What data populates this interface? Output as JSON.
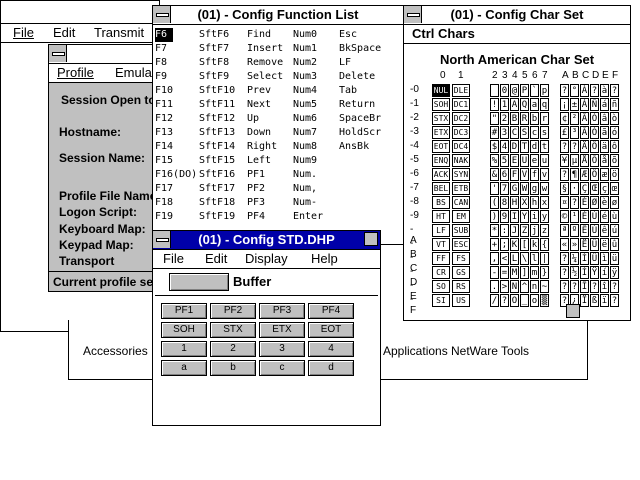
{
  "back_window": {
    "menu": [
      "File",
      "Edit",
      "Transmit"
    ]
  },
  "session_window": {
    "menu": [
      "Profile",
      "Emula"
    ],
    "session_open": "Session Open to",
    "hostname_label": "Hostname:",
    "session_name_label": "Session Name:",
    "profile_file_label": "Profile File Name",
    "logon_script_label": "Logon Script:",
    "keyboard_map_label": "Keyboard Map:",
    "keypad_map_label": "Keypad Map:",
    "transport_label": "Transport",
    "status": "Current profile se"
  },
  "program_manager": {
    "groups": [
      "Accessories",
      "Applications",
      "NetWare Tools"
    ]
  },
  "func_list": {
    "title": "(01) - Config Function List",
    "rows": [
      [
        "F6",
        "SftF6",
        "Find",
        "Num0",
        "Esc"
      ],
      [
        "F7",
        "SftF7",
        "Insert",
        "Num1",
        "BkSpace"
      ],
      [
        "F8",
        "SftF8",
        "Remove",
        "Num2",
        "LF"
      ],
      [
        "F9",
        "SftF9",
        "Select",
        "Num3",
        "Delete"
      ],
      [
        "F10",
        "SftF10",
        "Prev",
        "Num4",
        "Tab"
      ],
      [
        "F11",
        "SftF11",
        "Next",
        "Num5",
        "Return"
      ],
      [
        "F12",
        "SftF12",
        "Up",
        "Num6",
        "SpaceBr"
      ],
      [
        "F13",
        "SftF13",
        "Down",
        "Num7",
        "HoldScr"
      ],
      [
        "F14",
        "SftF14",
        "Right",
        "Num8",
        "AnsBk"
      ],
      [
        "F15",
        "SftF15",
        "Left",
        "Num9",
        ""
      ],
      [
        "F16(DO)",
        "SftF16",
        "PF1",
        "Num.",
        ""
      ],
      [
        "F17",
        "SftF17",
        "PF2",
        "Num,",
        ""
      ],
      [
        "F18",
        "SftF18",
        "PF3",
        "Num-",
        ""
      ],
      [
        "F19",
        "SftF19",
        "PF4",
        "Enter",
        ""
      ]
    ]
  },
  "char_set": {
    "title": "(01) - Config Char Set",
    "menu": "Ctrl Chars",
    "heading": "North American Char Set",
    "col_labels": [
      "0",
      "1",
      "2",
      "3",
      "4",
      "5",
      "6",
      "7",
      "A",
      "B",
      "C",
      "D",
      "E",
      "F"
    ],
    "row_labels": [
      "-0",
      "-1",
      "-2",
      "-3",
      "-4",
      "-5",
      "-6",
      "-7",
      "-8",
      "-9",
      "-A",
      "-B",
      "-C",
      "-D",
      "-E",
      "-F"
    ],
    "ctrl0": [
      "NUL",
      "SOH",
      "STX",
      "ETX",
      "EOT",
      "ENQ",
      "ACK",
      "BEL",
      "BS",
      "HT",
      "LF",
      "VT",
      "FF",
      "CR",
      "SO",
      "SI"
    ],
    "ctrl1": [
      "DLE",
      "DC1",
      "DC2",
      "DC3",
      "DC4",
      "NAK",
      "SYN",
      "ETB",
      "CAN",
      "EM",
      "SUB",
      "ESC",
      "FS",
      "GS",
      "RS",
      "US"
    ],
    "c2": [
      " ",
      "!",
      "\"",
      "#",
      "$",
      "%",
      "&",
      "'",
      "(",
      ")",
      "*",
      "+",
      ",",
      "-",
      ".",
      "/"
    ],
    "c3": [
      "0",
      "1",
      "2",
      "3",
      "4",
      "5",
      "6",
      "7",
      "8",
      "9",
      ":",
      ";",
      "<",
      "=",
      ">",
      "?"
    ],
    "c4": [
      "@",
      "A",
      "B",
      "C",
      "D",
      "E",
      "F",
      "G",
      "H",
      "I",
      "J",
      "K",
      "L",
      "M",
      "N",
      "O"
    ],
    "c5": [
      "P",
      "Q",
      "R",
      "S",
      "T",
      "U",
      "V",
      "W",
      "X",
      "Y",
      "Z",
      "[",
      "\\",
      "]",
      "^",
      "_"
    ],
    "c6": [
      "`",
      "a",
      "b",
      "c",
      "d",
      "e",
      "f",
      "g",
      "h",
      "i",
      "j",
      "k",
      "l",
      "m",
      "n",
      "o"
    ],
    "c7": [
      "p",
      "q",
      "r",
      "s",
      "t",
      "u",
      "v",
      "w",
      "x",
      "y",
      "z",
      "{",
      "|",
      "}",
      "~",
      "▒"
    ],
    "cA": [
      "?",
      "¡",
      "¢",
      "£",
      "?",
      "¥",
      "?",
      "§",
      "¤",
      "©",
      "ª",
      "«",
      "?",
      "?",
      "?",
      "?"
    ],
    "cB": [
      "°",
      "±",
      "²",
      "³",
      "?",
      "µ",
      "¶",
      "·",
      "?",
      "¹",
      "º",
      "»",
      "¼",
      "½",
      "?",
      "¿"
    ],
    "cC": [
      "À",
      "Á",
      "Â",
      "Ã",
      "Ä",
      "Å",
      "Æ",
      "Ç",
      "È",
      "É",
      "Ê",
      "Ë",
      "Ì",
      "Í",
      "Î",
      "Ï"
    ],
    "cD": [
      "?",
      "Ñ",
      "Ò",
      "Ó",
      "Ô",
      "Õ",
      "Ö",
      "Œ",
      "Ø",
      "Ù",
      "Ú",
      "Û",
      "Ü",
      "Ÿ",
      "?",
      "ß"
    ],
    "cE": [
      "à",
      "á",
      "â",
      "ã",
      "ä",
      "å",
      "æ",
      "ç",
      "è",
      "é",
      "ê",
      "ë",
      "ì",
      "í",
      "î",
      "ï"
    ],
    "cF": [
      "?",
      "ñ",
      "ò",
      "ó",
      "ô",
      "õ",
      "ö",
      "œ",
      "ø",
      "ù",
      "ú",
      "û",
      "ü",
      "ÿ",
      "?",
      "?"
    ]
  },
  "std_dhp": {
    "title": "(01) - Config STD.DHP",
    "menu": [
      "File",
      "Edit",
      "Display",
      "Help"
    ],
    "buffer": "Buffer",
    "keys": [
      [
        "PF1",
        "PF2",
        "PF3",
        "PF4"
      ],
      [
        "SOH",
        "STX",
        "ETX",
        "EOT"
      ],
      [
        "1",
        "2",
        "3",
        "4"
      ],
      [
        "a",
        "b",
        "c",
        "d"
      ]
    ]
  }
}
